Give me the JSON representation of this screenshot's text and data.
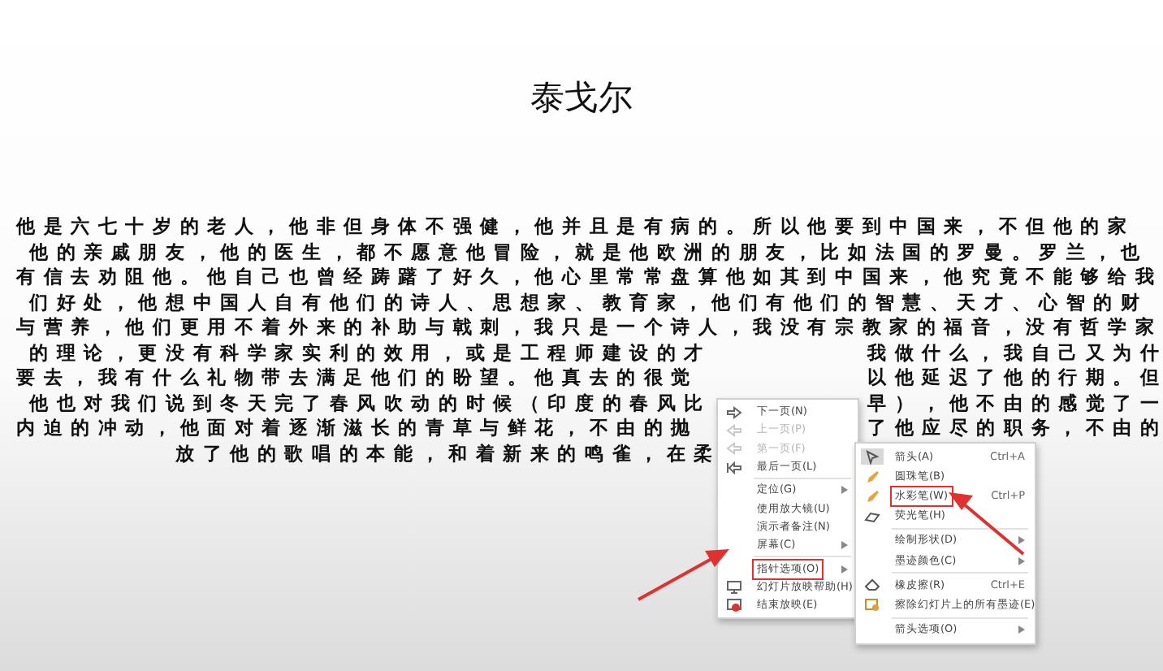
{
  "slide": {
    "title": "泰戈尔",
    "lines": [
      {
        "left": "他是六七十岁的老人，他非但身体不强健，他并且是有病的。所以他要到中国来，不但他的家"
      },
      {
        "left": "他的亲戚朋友，他的医生，都不愿意他冒险，就是他欧洲的朋友，比如法国的罗曼。罗兰，也"
      },
      {
        "left": "有信去劝阻他。他自己也曾经踌躇了好久，他心里常常盘算他如其到中国来，他究竟不能够给我"
      },
      {
        "left": "们好处，他想中国人自有他们的诗人、思想家、教育家，他们有他们的智慧、天才、心智的财"
      },
      {
        "left": "与营养，他们更用不着外来的补助与戟刺，我只是一个诗人，我没有宗教家的福音，没有哲学家"
      },
      {
        "left": "的理论，更没有科学家实利的效用，或是工程师建设的才",
        "right": "我做什么，我自己又为什"
      },
      {
        "left": "要去，我有什么礼物带去满足他们的盼望。他真去的很觉",
        "right": "以他延迟了他的行期。但"
      },
      {
        "left": "他也对我们说到冬天完了春风吹动的时候（印度的春风比",
        "right": "早），他不由的感觉了一"
      },
      {
        "left": "内迫的冲动，他面对着逐渐滋长的青草与鲜花，不由的抛",
        "right": "了他应尽的职务，不由的"
      },
      {
        "left": "放了他的歌唱的本能，和着新来的鸣雀，在柔",
        "kind": "last"
      }
    ]
  },
  "context_menu": {
    "items": [
      {
        "kind": "item",
        "label": "下一页(N)",
        "disabled": false,
        "submenu": false,
        "highlighted": false
      },
      {
        "kind": "item",
        "label": "上一页(P)",
        "disabled": true,
        "submenu": false,
        "highlighted": false
      },
      {
        "kind": "item",
        "label": "第一页(F)",
        "disabled": true,
        "submenu": false,
        "highlighted": false
      },
      {
        "kind": "item",
        "label": "最后一页(L)",
        "disabled": false,
        "submenu": false,
        "highlighted": false
      },
      {
        "kind": "separator"
      },
      {
        "kind": "item",
        "label": "定位(G)",
        "disabled": false,
        "submenu": true,
        "highlighted": false
      },
      {
        "kind": "item",
        "label": "使用放大镜(U)",
        "disabled": false,
        "submenu": false,
        "highlighted": false
      },
      {
        "kind": "item",
        "label": "演示者备注(N)",
        "disabled": false,
        "submenu": false,
        "highlighted": false
      },
      {
        "kind": "item",
        "label": "屏幕(C)",
        "disabled": false,
        "submenu": true,
        "highlighted": false
      },
      {
        "kind": "separator"
      },
      {
        "kind": "item",
        "label": "指针选项(O)",
        "disabled": false,
        "submenu": true,
        "highlighted": true
      },
      {
        "kind": "item",
        "label": "幻灯片放映帮助(H)",
        "disabled": false,
        "submenu": false,
        "highlighted": false
      },
      {
        "kind": "item",
        "label": "结束放映(E)",
        "disabled": false,
        "submenu": false,
        "highlighted": false
      }
    ]
  },
  "pointer_submenu": {
    "items": [
      {
        "kind": "item",
        "label": "箭头(A)",
        "shortcut": "Ctrl+A",
        "selected": true,
        "submenu": false,
        "highlighted": false
      },
      {
        "kind": "item",
        "label": "圆珠笔(B)",
        "selected": false,
        "submenu": false,
        "highlighted": false
      },
      {
        "kind": "item",
        "label": "水彩笔(W)",
        "shortcut": "Ctrl+P",
        "selected": false,
        "submenu": false,
        "highlighted": true
      },
      {
        "kind": "item",
        "label": "荧光笔(H)",
        "selected": false,
        "submenu": false,
        "highlighted": false
      },
      {
        "kind": "separator"
      },
      {
        "kind": "item",
        "label": "绘制形状(D)",
        "selected": false,
        "submenu": true,
        "highlighted": false
      },
      {
        "kind": "item",
        "label": "墨迹颜色(C)",
        "selected": false,
        "submenu": true,
        "highlighted": false
      },
      {
        "kind": "separator"
      },
      {
        "kind": "item",
        "label": "橡皮擦(R)",
        "shortcut": "Ctrl+E",
        "selected": false,
        "submenu": false,
        "highlighted": false
      },
      {
        "kind": "item",
        "label": "擦除幻灯片上的所有墨迹(E)",
        "selected": false,
        "submenu": false,
        "highlighted": false
      },
      {
        "kind": "separator"
      },
      {
        "kind": "item",
        "label": "箭头选项(O)",
        "selected": false,
        "submenu": true,
        "highlighted": false
      }
    ]
  }
}
